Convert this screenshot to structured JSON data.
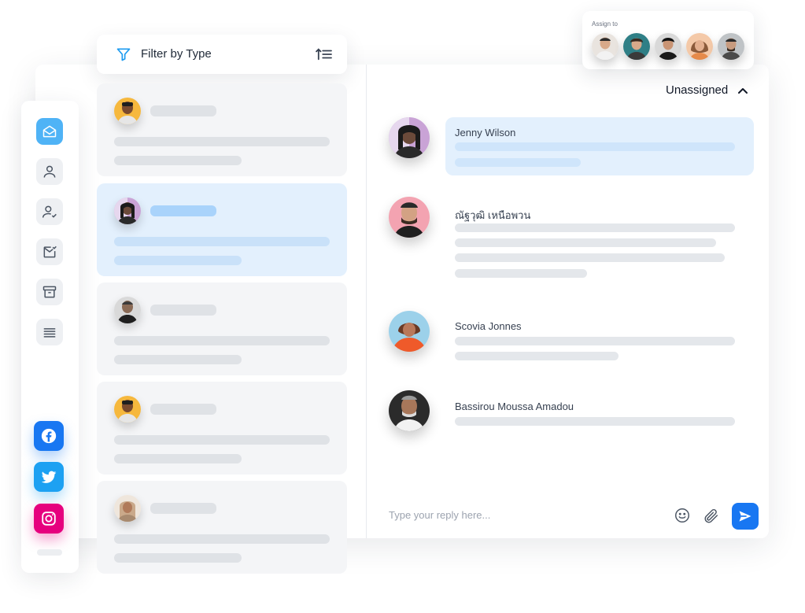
{
  "filter": {
    "label": "Filter by Type",
    "icon": "funnel-icon",
    "sort_icon": "sort-ascending-icon"
  },
  "rail": {
    "items": [
      {
        "name": "inbox",
        "icon": "mail-open-icon",
        "active": true
      },
      {
        "name": "contacts",
        "icon": "user-icon",
        "active": false
      },
      {
        "name": "assigned",
        "icon": "user-check-icon",
        "active": false
      },
      {
        "name": "resolved",
        "icon": "mail-check-icon",
        "active": false
      },
      {
        "name": "archive",
        "icon": "archive-icon",
        "active": false
      },
      {
        "name": "more",
        "icon": "list-icon",
        "active": false
      }
    ],
    "socials": [
      {
        "name": "facebook",
        "icon": "facebook-icon",
        "color": "#1877f2"
      },
      {
        "name": "twitter",
        "icon": "twitter-icon",
        "color": "#1da1f2"
      },
      {
        "name": "instagram",
        "icon": "instagram-icon",
        "color": "#e6007e"
      }
    ]
  },
  "conversations": [
    {
      "avatar": "avatar-man-yellow",
      "selected": false
    },
    {
      "avatar": "avatar-woman-purple",
      "selected": true
    },
    {
      "avatar": "avatar-man-grey",
      "selected": false
    },
    {
      "avatar": "avatar-man-yellow",
      "selected": false
    },
    {
      "avatar": "avatar-woman-hijab",
      "selected": false
    }
  ],
  "assign": {
    "label": "Assign to",
    "agents": 5
  },
  "chat": {
    "status": "Unassigned",
    "messages": [
      {
        "sender": "Jenny Wilson",
        "highlighted": true
      },
      {
        "sender": "ณัฐวุฒิ เหนือพวน",
        "highlighted": false
      },
      {
        "sender": "Scovia Jonnes",
        "highlighted": false
      },
      {
        "sender": "Bassirou Moussa Amadou",
        "highlighted": false
      }
    ],
    "reply_placeholder": "Type your reply here...",
    "send_icon": "send-icon"
  },
  "colors": {
    "accent": "#1877f2",
    "active_rail": "#4fb3f6",
    "selected_bg": "#e3f0fd"
  }
}
